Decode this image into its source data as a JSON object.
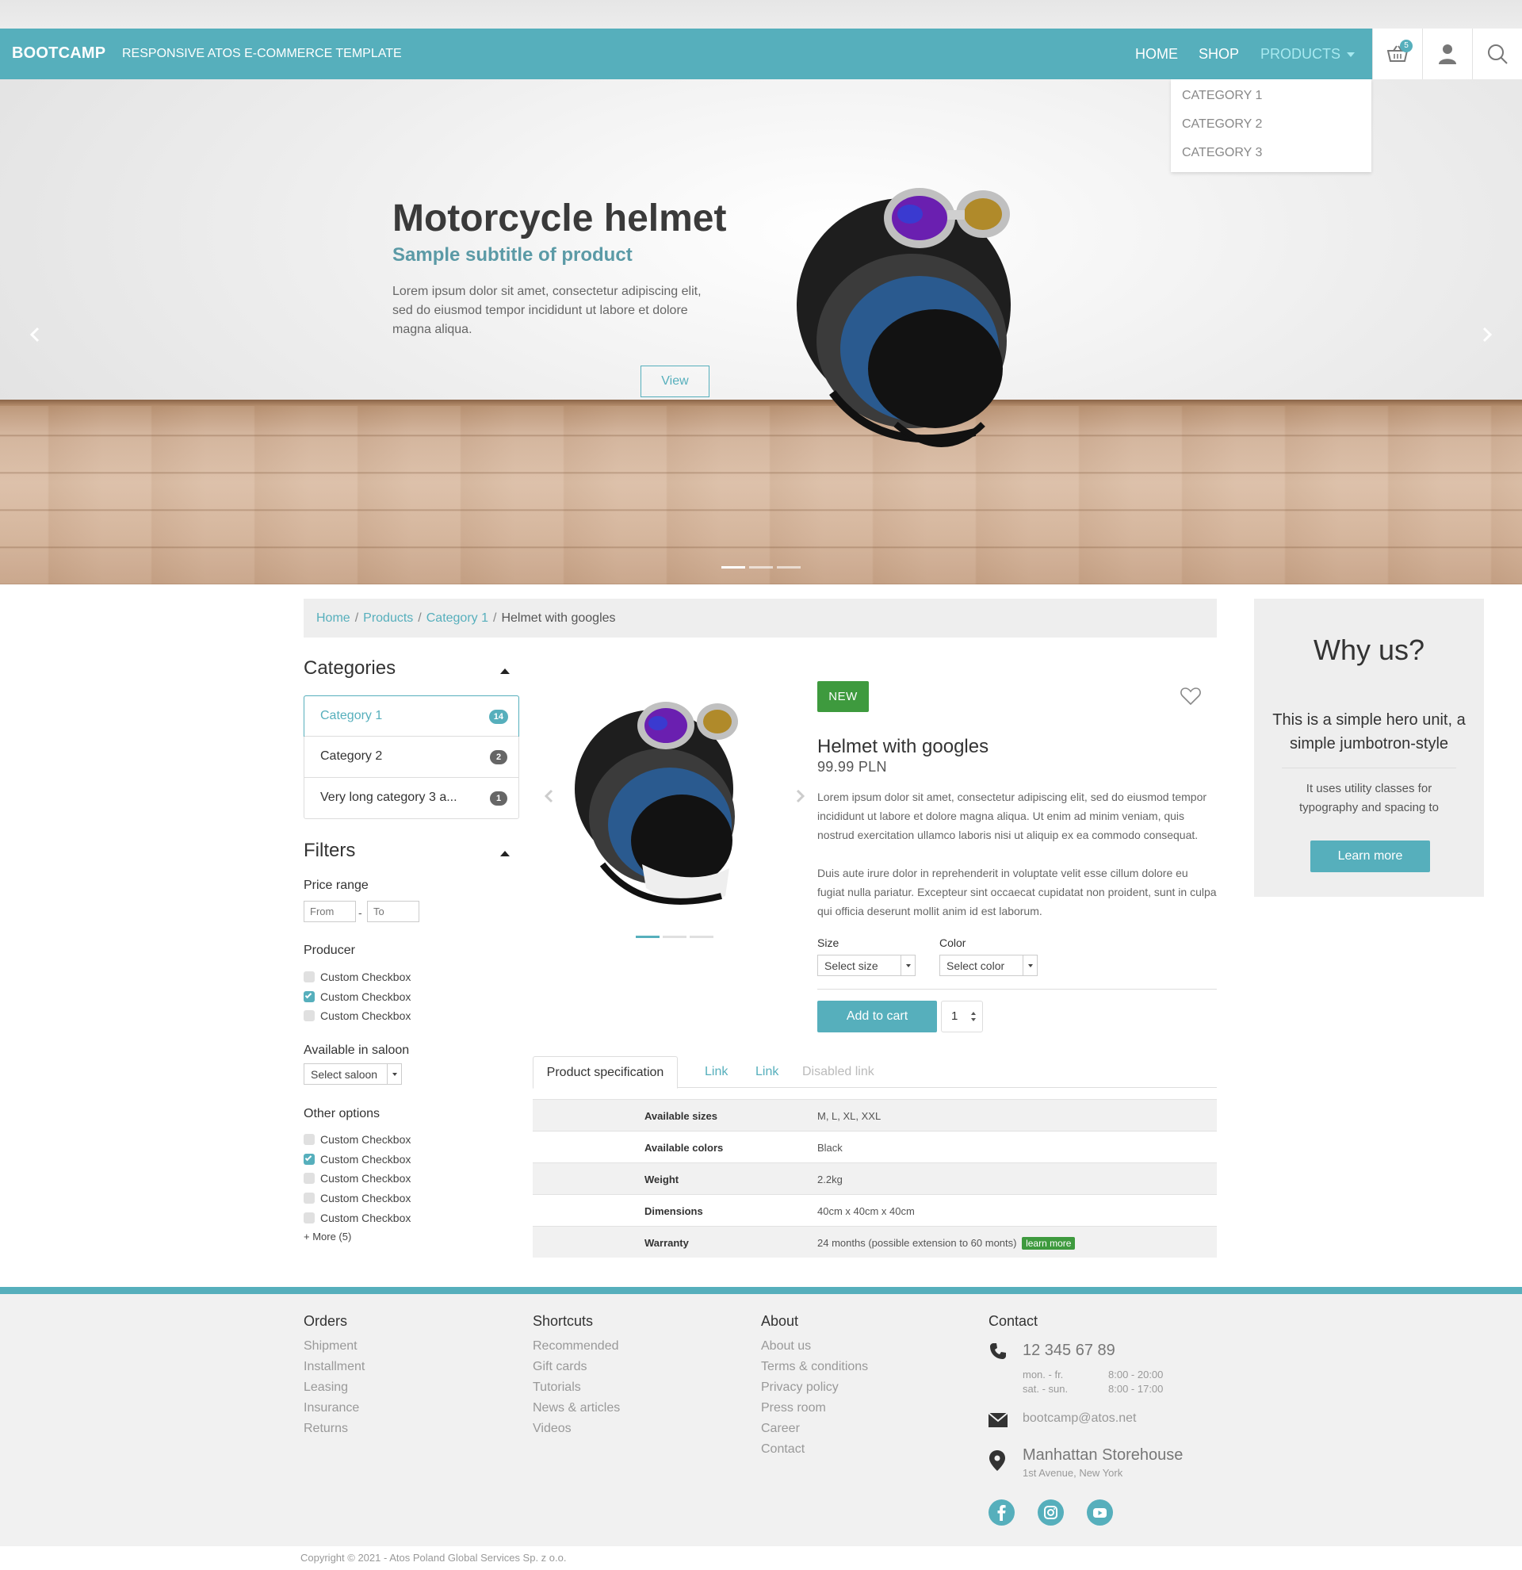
{
  "navbar": {
    "brand": "BOOTCAMP",
    "tagline": "RESPONSIVE ATOS E-COMMERCE TEMPLATE",
    "links": [
      "HOME",
      "SHOP",
      "PRODUCTS"
    ],
    "cart_count": "5",
    "icons": [
      "basket-icon",
      "user-icon",
      "search-icon"
    ]
  },
  "products_menu": [
    "CATEGORY 1",
    "CATEGORY 2",
    "CATEGORY 3"
  ],
  "hero": {
    "title": "Motorcycle helmet",
    "subtitle": "Sample subtitle of product",
    "text": "Lorem ipsum dolor sit amet, consectetur adipiscing elit, sed do eiusmod tempor incididunt ut labore et dolore magna aliqua.",
    "button": "View",
    "slide_count": 3,
    "active_slide": 1
  },
  "breadcrumb": [
    "Home",
    "Products",
    "Category 1",
    "Helmet with googles"
  ],
  "categories": {
    "title": "Categories",
    "items": [
      {
        "label": "Category 1",
        "count": "14"
      },
      {
        "label": "Category 2",
        "count": "2"
      },
      {
        "label": "Very long category 3 a...",
        "count": "1"
      }
    ]
  },
  "filters": {
    "title": "Filters",
    "price_label": "Price range",
    "price_from_placeholder": "From",
    "price_to_placeholder": "To",
    "producer_label": "Producer",
    "producer_options": [
      {
        "label": "Custom Checkbox",
        "checked": false
      },
      {
        "label": "Custom Checkbox",
        "checked": true
      },
      {
        "label": "Custom Checkbox",
        "checked": false
      }
    ],
    "saloon_label": "Available in saloon",
    "saloon_select": "Select saloon",
    "other_label": "Other options",
    "other_options": [
      {
        "label": "Custom Checkbox",
        "checked": false
      },
      {
        "label": "Custom Checkbox",
        "checked": true
      },
      {
        "label": "Custom Checkbox",
        "checked": false
      },
      {
        "label": "Custom Checkbox",
        "checked": false
      },
      {
        "label": "Custom Checkbox",
        "checked": false
      }
    ],
    "more": "+ More (5)"
  },
  "product": {
    "badge": "NEW",
    "name": "Helmet with googles",
    "price": "99.99 PLN",
    "desc1": "Lorem ipsum dolor sit amet, consectetur adipiscing elit, sed do eiusmod tempor incididunt ut labore et dolore magna aliqua. Ut enim ad minim veniam, quis nostrud exercitation ullamco laboris nisi ut aliquip ex ea commodo consequat.",
    "desc2": "Duis aute irure dolor in reprehenderit in voluptate velit esse cillum dolore eu fugiat nulla pariatur. Excepteur sint occaecat cupidatat non proident, sunt in culpa qui officia deserunt mollit anim id est laborum.",
    "size_label": "Size",
    "size_select": "Select size",
    "color_label": "Color",
    "color_select": "Select color",
    "add_to_cart": "Add to cart",
    "quantity": "1",
    "image_count": 3,
    "active_image": 1
  },
  "tabs": [
    "Product specification",
    "Link",
    "Link",
    "Disabled link"
  ],
  "specs": [
    {
      "key": "Available sizes",
      "value": "M, L, XL, XXL"
    },
    {
      "key": "Available colors",
      "value": "Black"
    },
    {
      "key": "Weight",
      "value": "2.2kg"
    },
    {
      "key": "Dimensions",
      "value": "40cm x 40cm x 40cm"
    },
    {
      "key": "Warranty",
      "value": "24 months (possible extension to 60 monts)",
      "badge": "learn more"
    }
  ],
  "jumbotron": {
    "title": "Why us?",
    "lead": "This is a simple hero unit, a simple jumbotron-style",
    "text": "It uses utility classes for typography and spacing to",
    "button": "Learn more"
  },
  "footer": {
    "orders": {
      "title": "Orders",
      "links": [
        "Shipment",
        "Installment",
        "Leasing",
        "Insurance",
        "Returns"
      ]
    },
    "shortcuts": {
      "title": "Shortcuts",
      "links": [
        "Recommended",
        "Gift cards",
        "Tutorials",
        "News & articles",
        "Videos"
      ]
    },
    "about": {
      "title": "About",
      "links": [
        "About us",
        "Terms & conditions",
        "Privacy policy",
        "Press room",
        "Career",
        "Contact"
      ]
    },
    "contact": {
      "title": "Contact",
      "phone": "12 345 67 89",
      "hours": [
        {
          "days": "mon. - fr.",
          "time": "8:00 - 20:00"
        },
        {
          "days": "sat. - sun.",
          "time": "8:00 - 17:00"
        }
      ],
      "email": "bootcamp@atos.net",
      "store": "Manhattan Storehouse",
      "address": "1st Avenue, New York",
      "social": [
        "facebook-icon",
        "instagram-icon",
        "youtube-icon"
      ]
    },
    "copyright": "Copyright © 2021 - Atos Poland Global Services Sp. z o.o."
  },
  "colors": {
    "accent": "#56afbc",
    "success": "#3e9a3e",
    "panel": "#eeeeee"
  }
}
